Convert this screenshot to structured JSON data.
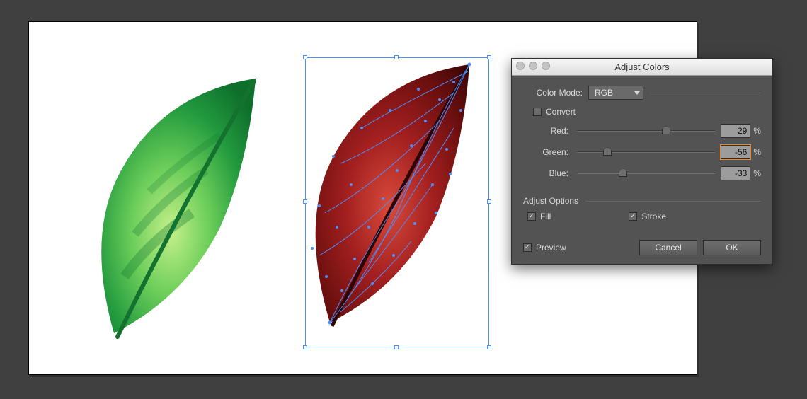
{
  "dialog": {
    "title": "Adjust Colors",
    "color_mode_label": "Color Mode:",
    "color_mode_value": "RGB",
    "convert_label": "Convert",
    "convert_checked": false,
    "channels": {
      "red": {
        "label": "Red:",
        "value": "29",
        "percent": 64.5,
        "active": false
      },
      "green": {
        "label": "Green:",
        "value": "-56",
        "percent": 22.0,
        "active": true
      },
      "blue": {
        "label": "Blue:",
        "value": "-33",
        "percent": 33.5,
        "active": false
      }
    },
    "adjust_options_label": "Adjust Options",
    "fill_label": "Fill",
    "fill_checked": true,
    "stroke_label": "Stroke",
    "stroke_checked": true,
    "preview_label": "Preview",
    "preview_checked": true,
    "cancel_label": "Cancel",
    "ok_label": "OK",
    "pct_symbol": "%"
  },
  "artwork": {
    "left_object": "green-leaf",
    "right_object_selected": "red-leaf"
  }
}
